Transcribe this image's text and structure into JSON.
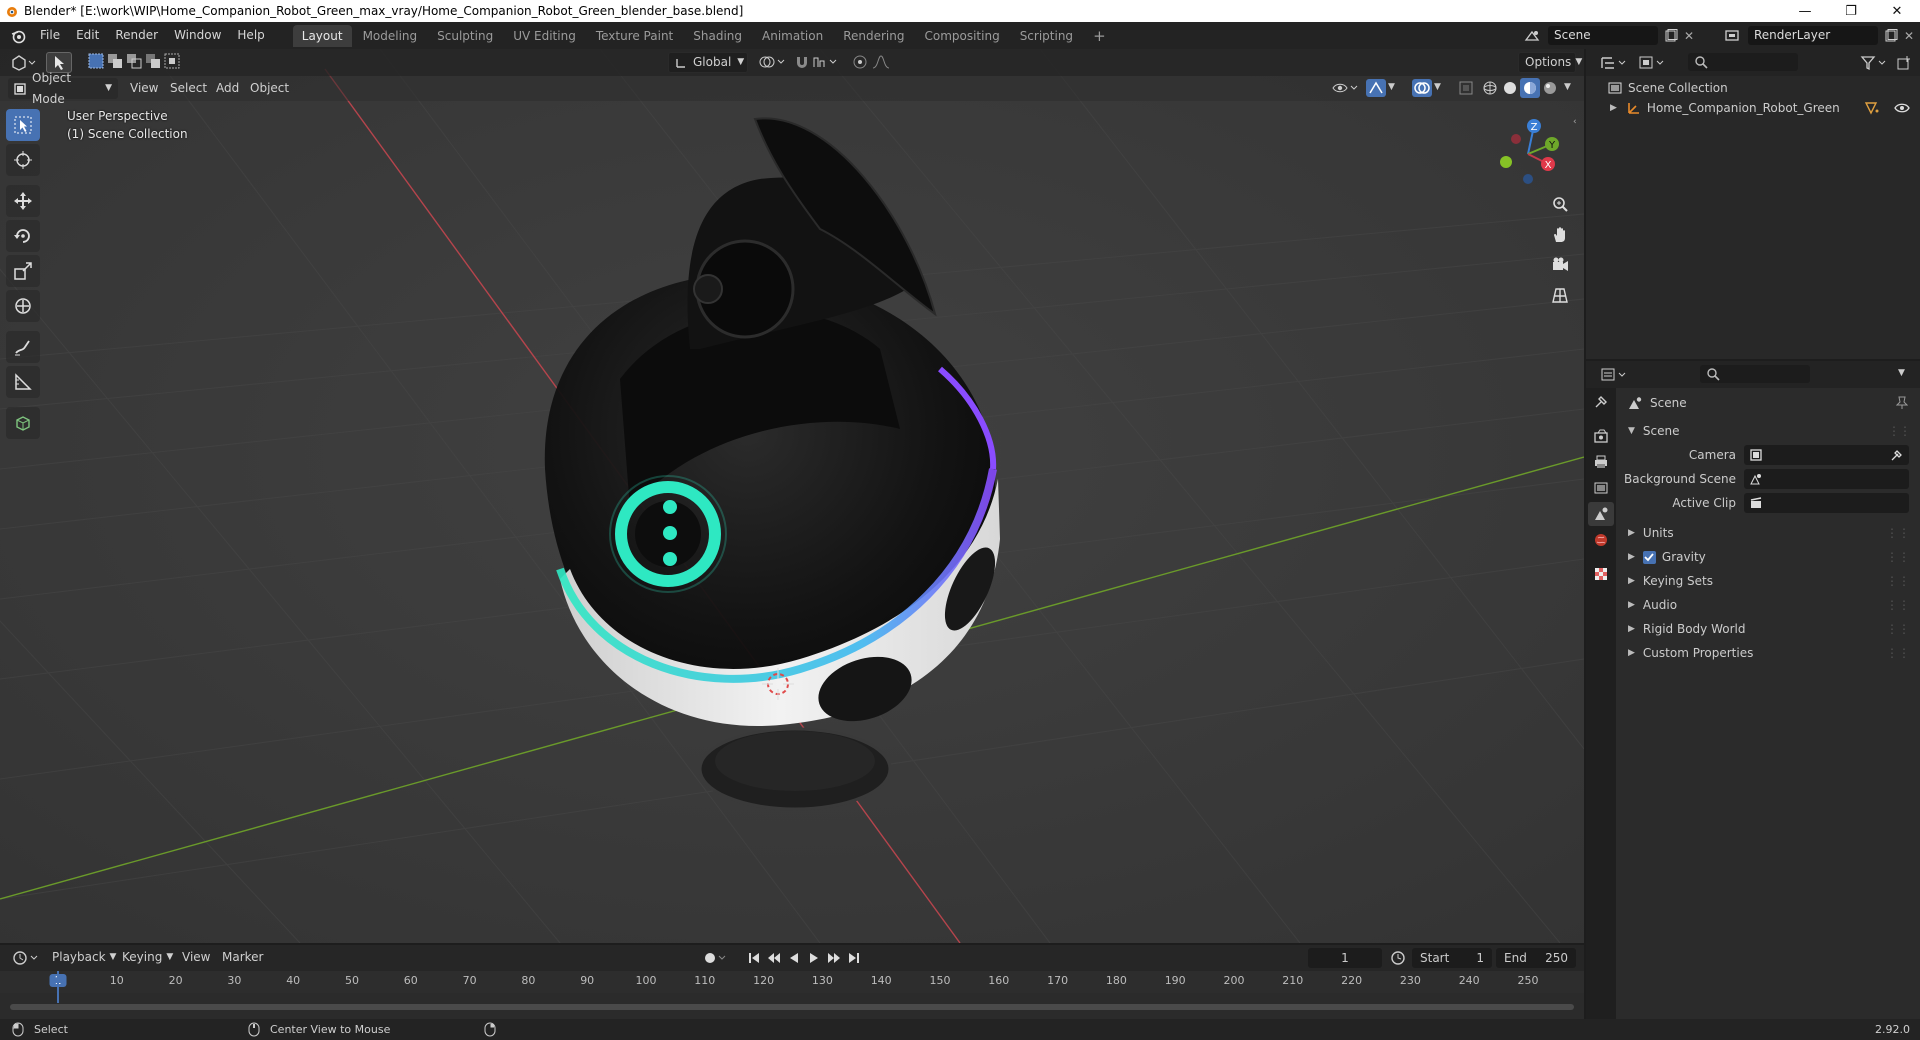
{
  "window": {
    "title": "Blender* [E:\\work\\WIP\\Home_Companion_Robot_Green_max_vray/Home_Companion_Robot_Green_blender_base.blend]"
  },
  "menu": {
    "items": [
      "File",
      "Edit",
      "Render",
      "Window",
      "Help"
    ],
    "workspaces": [
      "Layout",
      "Modeling",
      "Sculpting",
      "UV Editing",
      "Texture Paint",
      "Shading",
      "Animation",
      "Rendering",
      "Compositing",
      "Scripting"
    ],
    "active_workspace": "Layout",
    "scene_name": "Scene",
    "render_layer": "RenderLayer"
  },
  "viewport": {
    "mode": "Object Mode",
    "menus": [
      "View",
      "Select",
      "Add",
      "Object"
    ],
    "transform_orientation": "Global",
    "options_label": "Options",
    "overlay_line1": "User Perspective",
    "overlay_line2": "(1) Scene Collection",
    "gizmo_axes": {
      "x": "X",
      "y": "Y",
      "z": "Z"
    }
  },
  "outliner": {
    "root": "Scene Collection",
    "object": "Home_Companion_Robot_Green"
  },
  "properties": {
    "context_label": "Scene",
    "section_title": "Scene",
    "fields": [
      {
        "label": "Camera",
        "value": ""
      },
      {
        "label": "Background Scene",
        "value": ""
      },
      {
        "label": "Active Clip",
        "value": ""
      }
    ],
    "subpanels": [
      "Units",
      "Gravity",
      "Keying Sets",
      "Audio",
      "Rigid Body World",
      "Custom Properties"
    ],
    "gravity_enabled": true
  },
  "timeline": {
    "menus": [
      "Playback",
      "Keying",
      "View",
      "Marker"
    ],
    "current_frame": "1",
    "start_label": "Start",
    "start_value": "1",
    "end_label": "End",
    "end_value": "250",
    "ruler": [
      "1",
      "10",
      "20",
      "30",
      "40",
      "50",
      "60",
      "70",
      "80",
      "90",
      "100",
      "110",
      "120",
      "130",
      "140",
      "150",
      "160",
      "170",
      "180",
      "190",
      "200",
      "210",
      "220",
      "230",
      "240",
      "250"
    ]
  },
  "statusbar": {
    "left_action": "Select",
    "middle_action": "Center View to Mouse",
    "version": "2.92.0"
  },
  "colors": {
    "accent": "#4772b3",
    "x_axis": "#b5444c",
    "y_axis": "#6a9a2a",
    "glow_teal": "#2ee8c2",
    "glow_purple": "#8a4cff"
  }
}
